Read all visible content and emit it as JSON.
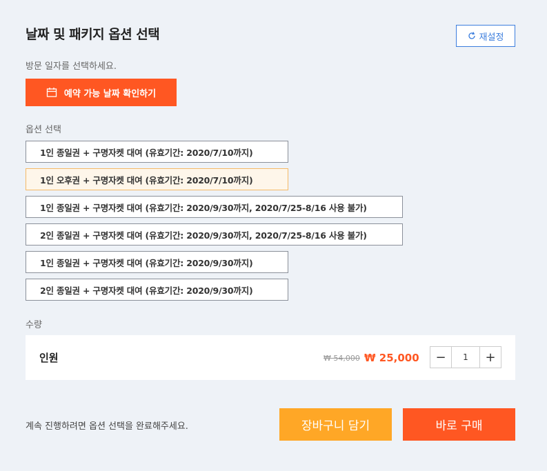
{
  "header": {
    "title": "날짜 및 패키지 옵션 선택",
    "reset_label": "재설정"
  },
  "date": {
    "label": "방문 일자를 선택하세요.",
    "button_label": "예약 가능 날짜 확인하기"
  },
  "options": {
    "label": "옵션 선택",
    "items": [
      {
        "label": "1인 종일권 + 구명자켓 대여 (유효기간: 2020/7/10까지)",
        "selected": false
      },
      {
        "label": "1인 오후권 + 구명자켓 대여 (유효기간: 2020/7/10까지)",
        "selected": true
      },
      {
        "label": "1인 종일권 + 구명자켓 대여 (유효기간: 2020/9/30까지, 2020/7/25-8/16 사용 불가)",
        "selected": false
      },
      {
        "label": "2인 종일권 + 구명자켓 대여 (유효기간: 2020/9/30까지, 2020/7/25-8/16 사용 불가)",
        "selected": false
      },
      {
        "label": "1인 종일권 + 구명자켓 대여 (유효기간: 2020/9/30까지)",
        "selected": false
      },
      {
        "label": "2인 종일권 + 구명자켓 대여 (유효기간: 2020/9/30까지)",
        "selected": false
      }
    ]
  },
  "quantity": {
    "label": "수량",
    "row_label": "인원",
    "original_price": "₩ 54,000",
    "sale_price": "₩ 25,000",
    "value": "1",
    "minus_symbol": "−",
    "plus_symbol": "+"
  },
  "footer": {
    "hint": "계속 진행하려면 옵션 선택을 완료해주세요.",
    "cart_label": "장바구니 담기",
    "buy_label": "바로 구매"
  },
  "colors": {
    "accent": "#ff5722",
    "cart": "#ffa726",
    "link": "#3b7ddd",
    "selected_bg": "#fef6ea"
  }
}
